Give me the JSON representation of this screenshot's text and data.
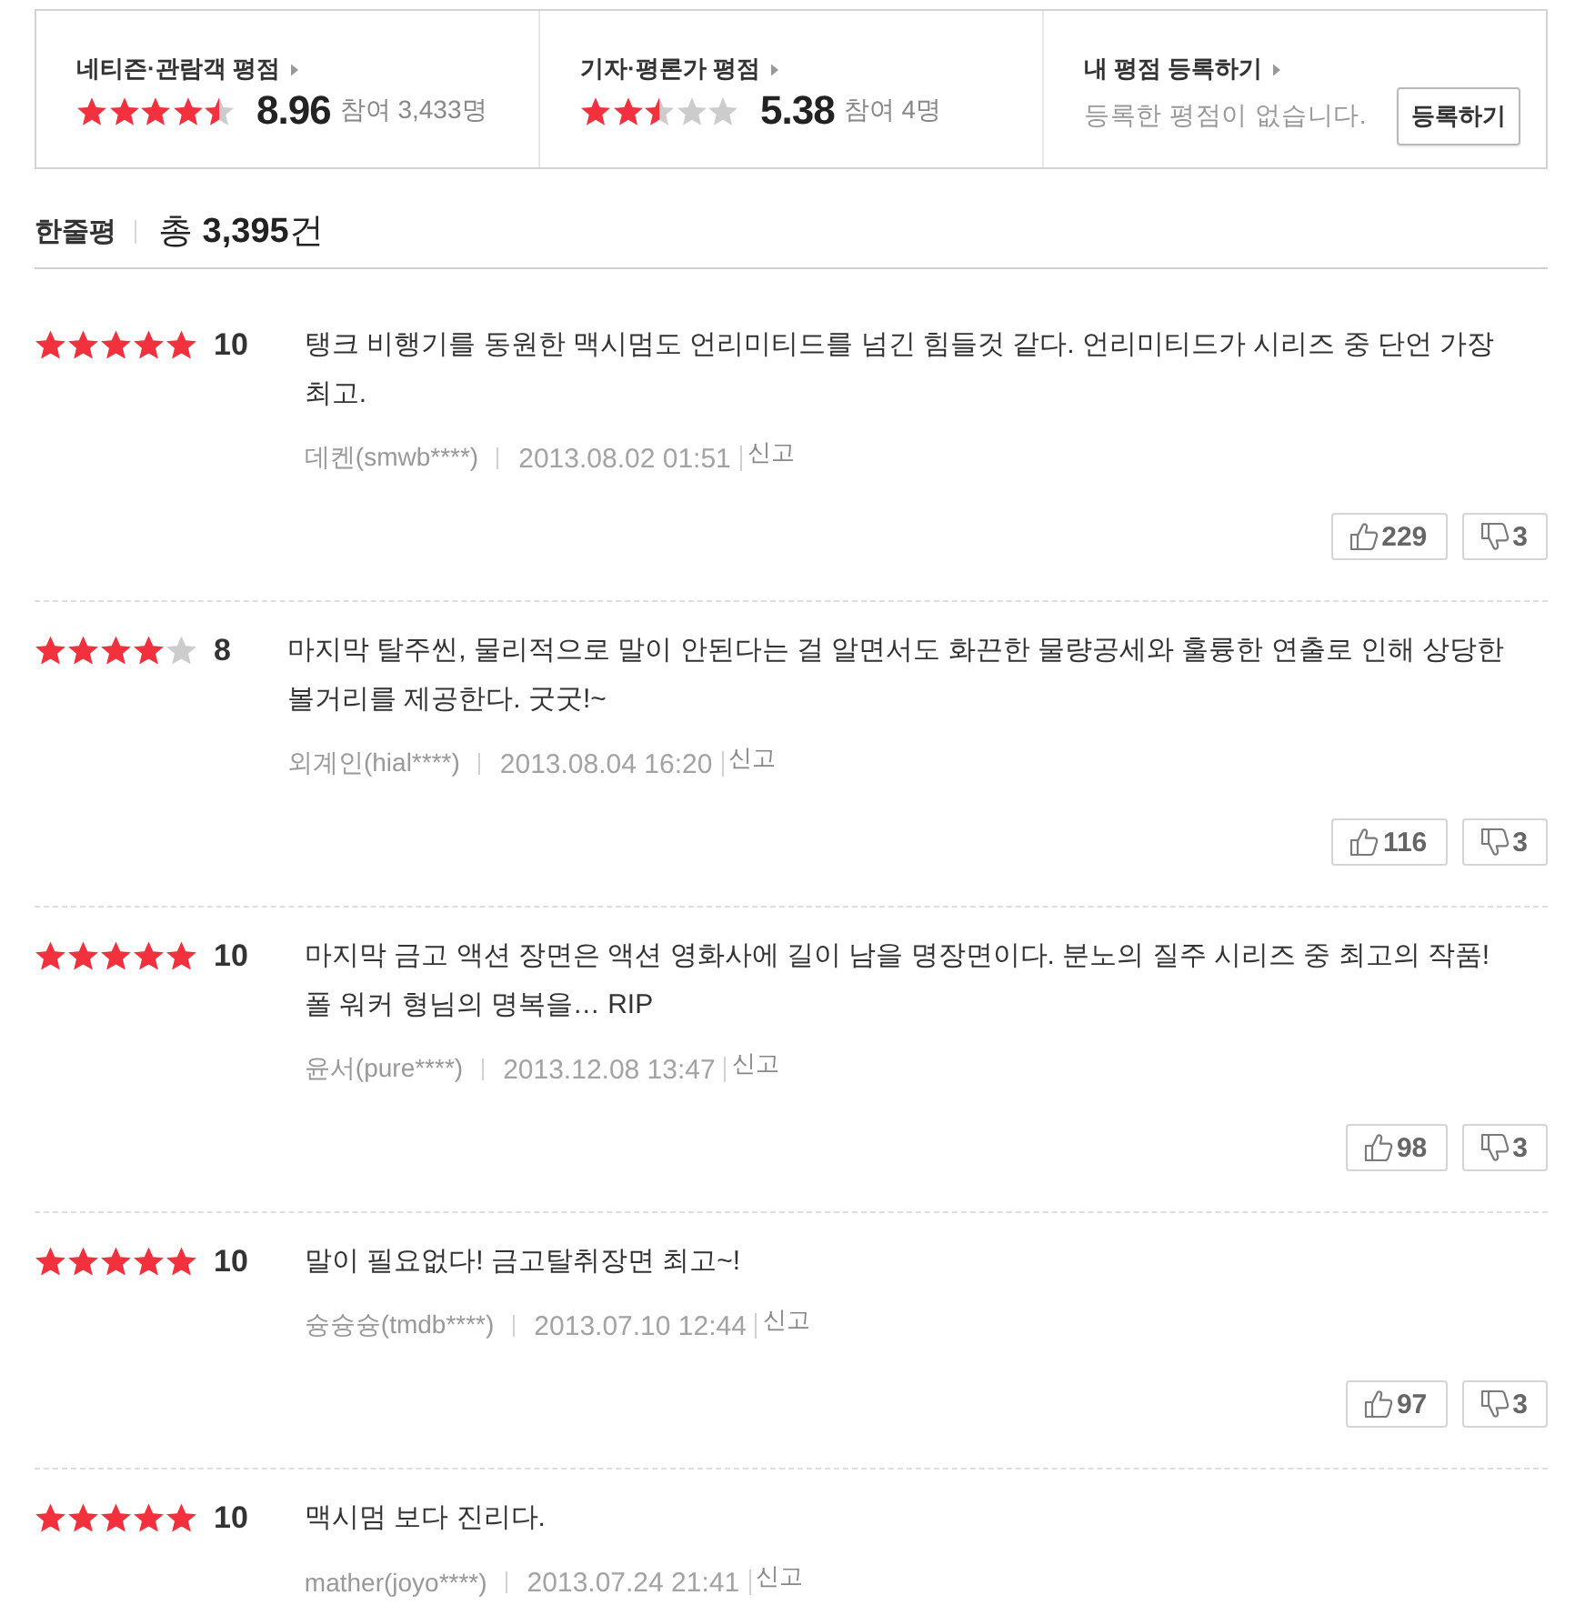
{
  "ratings": [
    {
      "kind": "score",
      "title": "네티즌·관람객 평점",
      "stars": 4.5,
      "score": "8.96",
      "participants": "참여 3,433명"
    },
    {
      "kind": "score",
      "title": "기자·평론가 평점",
      "stars": 2.5,
      "score": "5.38",
      "participants": "참여 4명"
    },
    {
      "kind": "register",
      "title": "내 평점 등록하기",
      "message": "등록한 평점이 없습니다.",
      "button": "등록하기"
    }
  ],
  "summary": {
    "title": "한줄평",
    "total": "총 **3,395**건"
  },
  "reviews": [
    {
      "stars": 5,
      "score": "10",
      "text": "탱크 비행기를 동원한 맥시멈도 언리미티드를 넘긴 힘들것 같다. 언리미티드가 시리즈 중 단언 가장 최고.",
      "author": "데켄(smwb****)",
      "date": "2013.08.02 01:51",
      "report": "신고",
      "likes": "229",
      "dislikes": "3"
    },
    {
      "stars": 4,
      "score": "8",
      "text": "마지막 탈주씬, 물리적으로 말이 안된다는 걸 알면서도 화끈한 물량공세와 훌륭한 연출로 인해 상당한 볼거리를 제공한다. 굿굿!~",
      "author": "외계인(hial****)",
      "date": "2013.08.04 16:20",
      "report": "신고",
      "likes": "116",
      "dislikes": "3"
    },
    {
      "stars": 5,
      "score": "10",
      "text": "마지막 금고 액션 장면은 액션 영화사에 길이 남을 명장면이다. 분노의 질주 시리즈 중 최고의 작품! 폴 워커 형님의 명복을… RIP",
      "author": "윤서(pure****)",
      "date": "2013.12.08 13:47",
      "report": "신고",
      "likes": "98",
      "dislikes": "3"
    },
    {
      "stars": 5,
      "score": "10",
      "text": "말이 필요없다! 금고탈취장면 최고~!",
      "author": "슝슝슝(tmdb****)",
      "date": "2013.07.10 12:44",
      "report": "신고",
      "likes": "97",
      "dislikes": "3"
    },
    {
      "stars": 5,
      "score": "10",
      "text": "맥시멈 보다 진리다.",
      "author": "mather(joyo****)",
      "date": "2013.07.24 21:41",
      "report": "신고"
    }
  ]
}
